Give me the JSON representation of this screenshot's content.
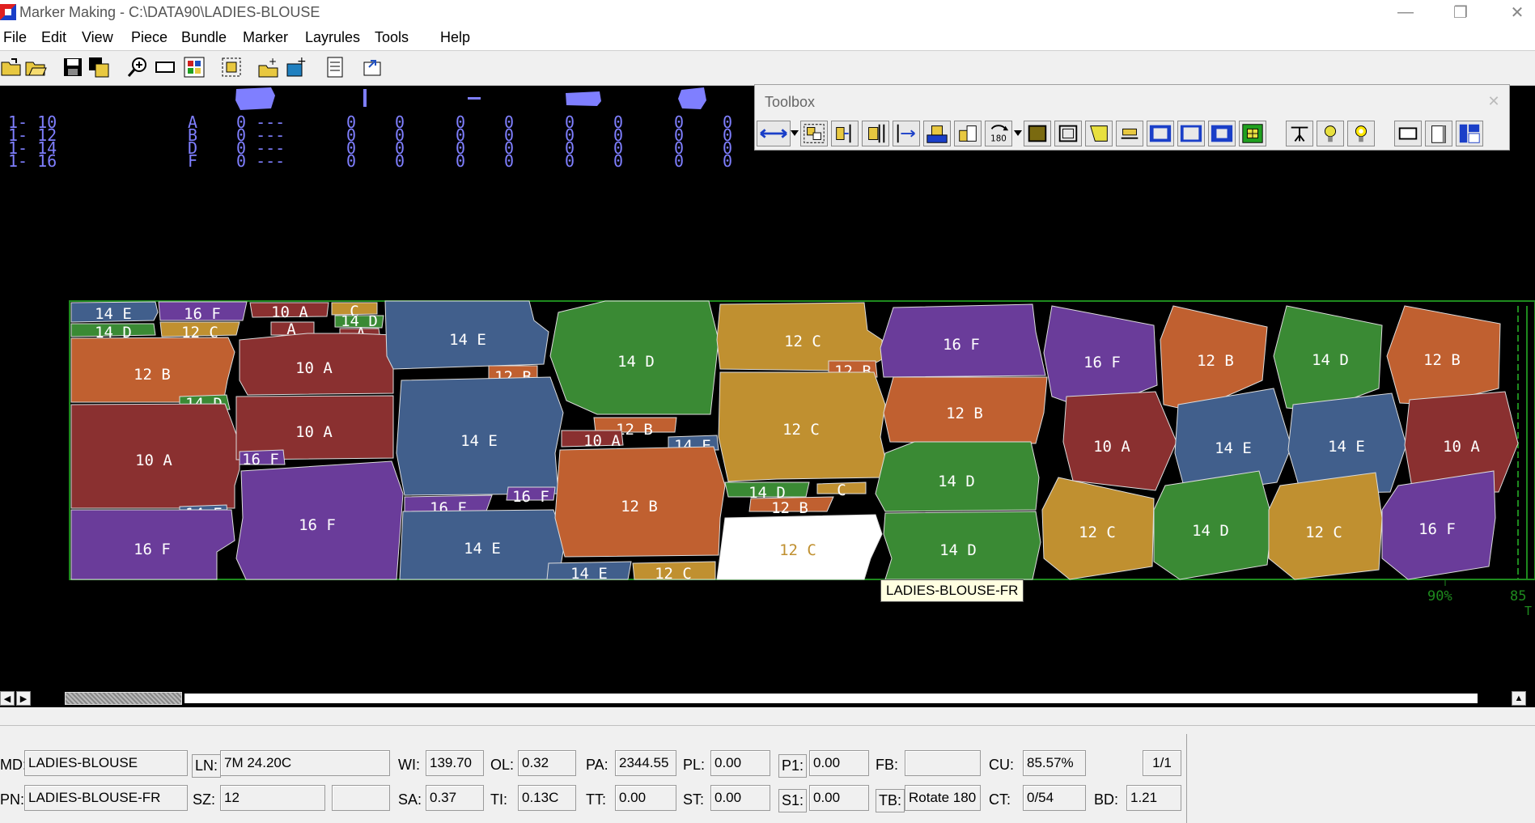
{
  "window": {
    "title": "Marker Making - C:\\DATA90\\LADIES-BLOUSE",
    "minimize_glyph": "—",
    "restore_glyph": "❐",
    "close_glyph": "✕"
  },
  "menu": {
    "items": [
      "File",
      "Edit",
      "View",
      "Piece",
      "Bundle",
      "Marker",
      "Layrules",
      "Tools",
      "Help"
    ]
  },
  "toolbar": {
    "buttons": [
      "open-icon",
      "open-folder-icon",
      "save-icon",
      "save-all-icon",
      "zoom-in-icon",
      "zoom-window-icon",
      "fit-icon",
      "select-icon",
      "add-piece-icon",
      "add-bundle-icon",
      "report-icon",
      "export-icon"
    ]
  },
  "size_table": {
    "rows": [
      {
        "size": "1-  10",
        "code": "A",
        "cols": [
          "0 ---",
          "0",
          "0",
          "0",
          "0",
          "0",
          "0",
          "0",
          "0"
        ]
      },
      {
        "size": "1-  12",
        "code": "B",
        "cols": [
          "0 ---",
          "0",
          "0",
          "0",
          "0",
          "0",
          "0",
          "0",
          "0"
        ]
      },
      {
        "size": "1-  14",
        "code": "D",
        "cols": [
          "0 ---",
          "0",
          "0",
          "0",
          "0",
          "0",
          "0",
          "0",
          "0"
        ]
      },
      {
        "size": "1-  16",
        "code": "F",
        "cols": [
          "0 ---",
          "0",
          "0",
          "0",
          "0",
          "0",
          "0",
          "0",
          "0"
        ]
      }
    ]
  },
  "colors": {
    "A": "#8a3030",
    "B": "#c06030",
    "C": "#c09030",
    "D": "#3a8a34",
    "E": "#415f8c",
    "F": "#6a3c9a",
    "selected": "#ffffff",
    "marker_border": "#1e8a1e",
    "canvas": "#000000"
  },
  "marker": {
    "pieces": [
      {
        "label": "14 E",
        "code": "E"
      },
      {
        "label": "16 F",
        "code": "F"
      },
      {
        "label": "10 A",
        "code": "A"
      },
      {
        "label": "C",
        "code": "C"
      },
      {
        "label": "14 D",
        "code": "D"
      },
      {
        "label": "12 C",
        "code": "C"
      },
      {
        "label": "A",
        "code": "A"
      },
      {
        "label": "14 D",
        "code": "D"
      },
      {
        "label": "A",
        "code": "A"
      },
      {
        "label": "12 B",
        "code": "B"
      },
      {
        "label": "10 A",
        "code": "A"
      },
      {
        "label": "14 D",
        "code": "D"
      },
      {
        "label": "10 A",
        "code": "A"
      },
      {
        "label": "10 A",
        "code": "A"
      },
      {
        "label": "16 F",
        "code": "F"
      },
      {
        "label": "14 E",
        "code": "E"
      },
      {
        "label": "16 F",
        "code": "F"
      },
      {
        "label": "16 F",
        "code": "F"
      },
      {
        "label": "14 E",
        "code": "E"
      },
      {
        "label": "12 B",
        "code": "B"
      },
      {
        "label": "14 E",
        "code": "E"
      },
      {
        "label": "16 F",
        "code": "F"
      },
      {
        "label": "16 F",
        "code": "F"
      },
      {
        "label": "14 E",
        "code": "E"
      },
      {
        "label": "14 D",
        "code": "D"
      },
      {
        "label": "12 B",
        "code": "B"
      },
      {
        "label": "10 A",
        "code": "A"
      },
      {
        "label": "14 E",
        "code": "E"
      },
      {
        "label": "12 B",
        "code": "B"
      },
      {
        "label": "14 E",
        "code": "E"
      },
      {
        "label": "12 C",
        "code": "C"
      },
      {
        "label": "12 C",
        "code": "C"
      },
      {
        "label": "12 B",
        "code": "B"
      },
      {
        "label": "12 C",
        "code": "C"
      },
      {
        "label": "14 D",
        "code": "D"
      },
      {
        "label": "12 B",
        "code": "B"
      },
      {
        "label": "C",
        "code": "C"
      },
      {
        "label": "12 C",
        "code": "C"
      },
      {
        "label": "16 F",
        "code": "F"
      },
      {
        "label": "12 B",
        "code": "B"
      },
      {
        "label": "14 D",
        "code": "D"
      },
      {
        "label": "14 D",
        "code": "D"
      },
      {
        "label": "16 F",
        "code": "F"
      },
      {
        "label": "10 A",
        "code": "A"
      },
      {
        "label": "12 C",
        "code": "C"
      },
      {
        "label": "12 B",
        "code": "B"
      },
      {
        "label": "14 E",
        "code": "E"
      },
      {
        "label": "14 D",
        "code": "D"
      },
      {
        "label": "14 D",
        "code": "D"
      },
      {
        "label": "14 E",
        "code": "E"
      },
      {
        "label": "12 C",
        "code": "C"
      },
      {
        "label": "12 B",
        "code": "B"
      },
      {
        "label": "10 A",
        "code": "A"
      },
      {
        "label": "16 F",
        "code": "F"
      }
    ],
    "scale_left": "90%",
    "scale_right": "85",
    "scale_right_sub": "T"
  },
  "toolbox": {
    "title": "Toolbox",
    "close_glyph": "✕",
    "buttons": [
      "move-arrows-icon",
      "dropdown-icon",
      "group-icon",
      "align-right-icon",
      "butt-right-icon",
      "slide-right-icon",
      "piece-stack-icon",
      "rotate-90-icon",
      "rotate-180-icon",
      "dropdown-icon",
      "fill-piece-icon",
      "outline-piece-icon",
      "half-piece-icon",
      "flag-icon",
      "frame-left-icon",
      "frame-center-icon",
      "frame-small-icon",
      "grid-icon",
      "compass-icon",
      "bulb-icon",
      "bulb-on-icon",
      "rect-icon",
      "page-icon",
      "split-view-icon"
    ],
    "rotate_label": "180"
  },
  "tooltip": "LADIES-BLOUSE-FR",
  "status": {
    "md_label": "MD:",
    "md_value": "LADIES-BLOUSE",
    "pn_label": "PN:",
    "pn_value": "LADIES-BLOUSE-FR",
    "ln_label": "LN:",
    "ln_value": "7M 24.20C",
    "sz_label": "SZ:",
    "sz_value": "12",
    "blank_value": "",
    "wi_label": "WI:",
    "wi_value": "139.70",
    "sa_label": "SA:",
    "sa_value": "0.37",
    "ol_label": "OL:",
    "ol_value": "0.32",
    "ti_label": "TI:",
    "ti_value": "0.13C",
    "pa_label": "PA:",
    "pa_value": "2344.55",
    "tt_label": "TT:",
    "tt_value": "0.00",
    "pl_label": "PL:",
    "pl_value": "0.00",
    "st_label": "ST:",
    "st_value": "0.00",
    "p1_label": "P1:",
    "p1_value": "0.00",
    "s1_label": "S1:",
    "s1_value": "0.00",
    "fb_label": "FB:",
    "fb_value": "",
    "tb_label": "TB:",
    "tb_value": "Rotate 180",
    "cu_label": "CU:",
    "cu_value": "85.57%",
    "ct_label": "CT:",
    "ct_value": "0/54",
    "page_value": "1/1",
    "bd_label": "BD:",
    "bd_value": "1.21"
  }
}
